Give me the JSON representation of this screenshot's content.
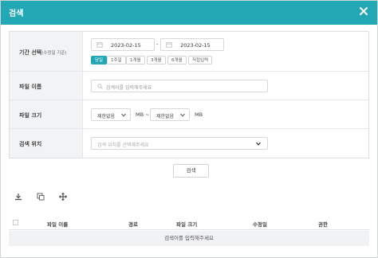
{
  "dialog": {
    "title": "검색",
    "close_icon": "close-icon",
    "accent_color": "#22a7b4"
  },
  "form": {
    "period": {
      "label": "기간 선택",
      "label_note": "(수정일 기준)",
      "start_date": "2023-02-15",
      "separator": "-",
      "end_date": "2023-02-15",
      "quick_ranges": [
        "당일",
        "1주일",
        "1개월",
        "3개월",
        "6개월",
        "직접입력"
      ],
      "active_index": 0
    },
    "file_name": {
      "label": "파일 이름",
      "placeholder": "검색어를 입력해주세요"
    },
    "file_size": {
      "label": "파일 크기",
      "min_value": "제한없음",
      "min_unit": "MB ~",
      "max_value": "제한없음",
      "max_unit": "MB"
    },
    "location": {
      "label": "검색 위치",
      "placeholder": "검색 위치를 선택해주세요"
    }
  },
  "search_button": "검색",
  "toolbar": {
    "icons": [
      "download-icon",
      "copy-icon",
      "move-icon"
    ]
  },
  "table": {
    "columns": [
      "파일 이름",
      "경로",
      "파일 크기",
      "수정일",
      "권한"
    ],
    "empty_message": "검색어를 입력해주세요"
  }
}
